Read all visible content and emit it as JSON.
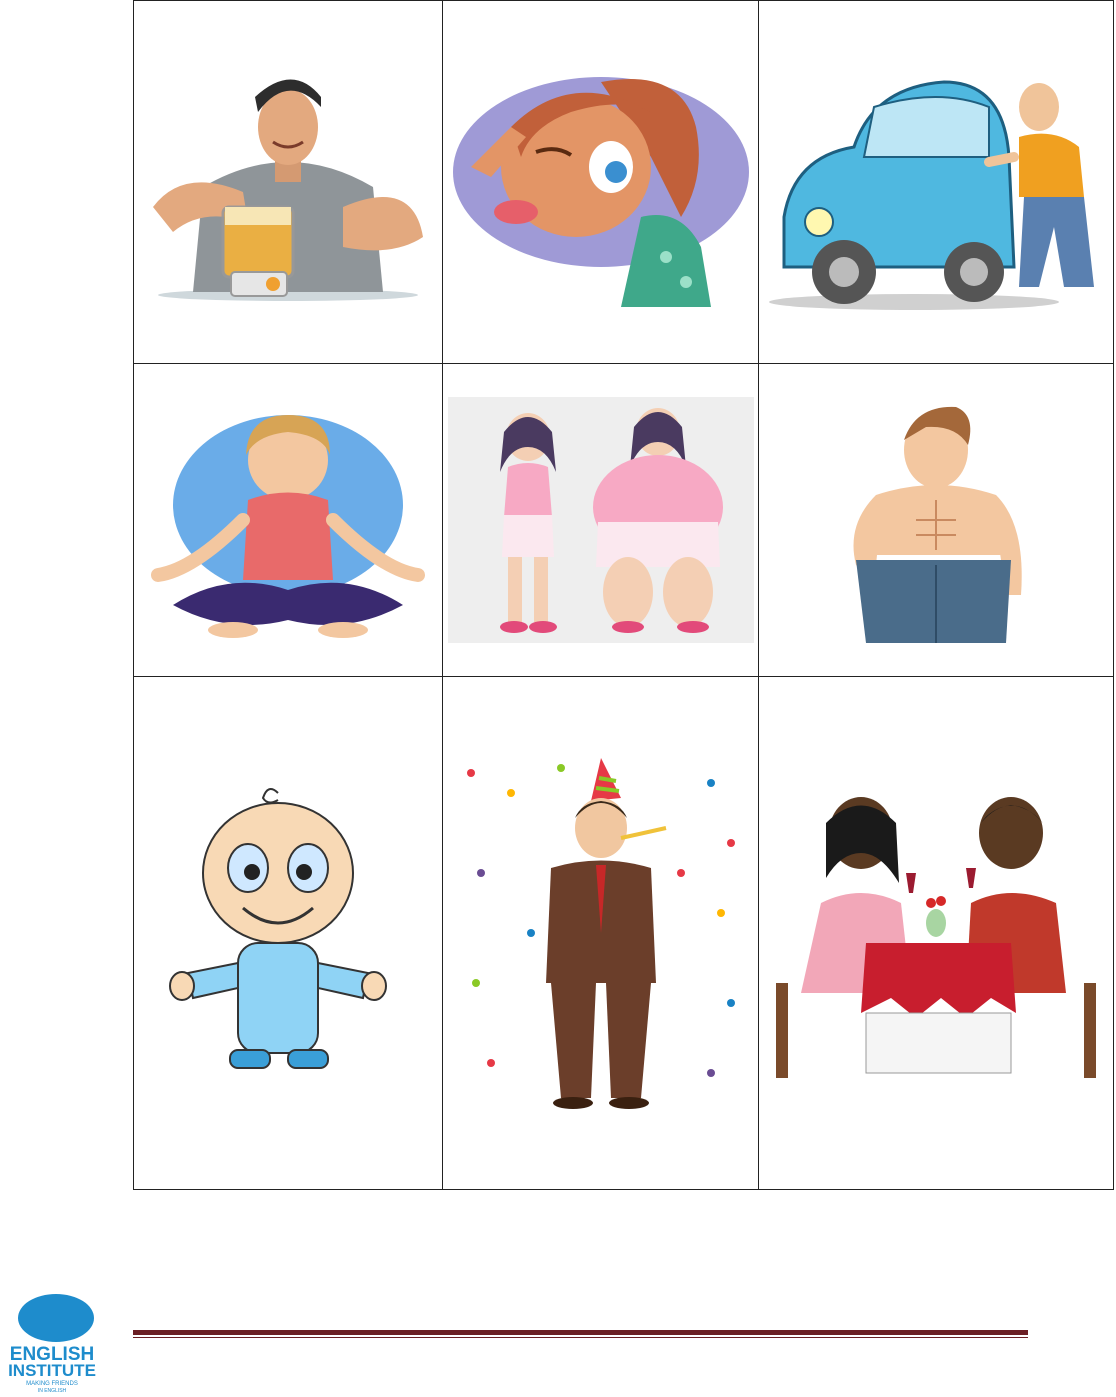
{
  "worksheet": {
    "cells": [
      {
        "subject": "muscular-man-blender",
        "row": 1,
        "col": 1
      },
      {
        "subject": "girl-making-face",
        "row": 1,
        "col": 2
      },
      {
        "subject": "man-pushing-car",
        "row": 1,
        "col": 3
      },
      {
        "subject": "woman-meditating",
        "row": 2,
        "col": 1
      },
      {
        "subject": "thin-and-fat-woman",
        "row": 2,
        "col": 2
      },
      {
        "subject": "man-with-loose-jeans",
        "row": 2,
        "col": 3
      },
      {
        "subject": "baby",
        "row": 3,
        "col": 1
      },
      {
        "subject": "man-at-party",
        "row": 3,
        "col": 2
      },
      {
        "subject": "couple-dinner-date",
        "row": 3,
        "col": 3
      }
    ]
  },
  "footer": {
    "logo": {
      "line1": "ENGLISH",
      "line2": "INSTITUTE",
      "tagline1": "MAKING FRIENDS",
      "tagline2": "IN ENGLISH"
    },
    "rule_color": "#6b1f24"
  }
}
